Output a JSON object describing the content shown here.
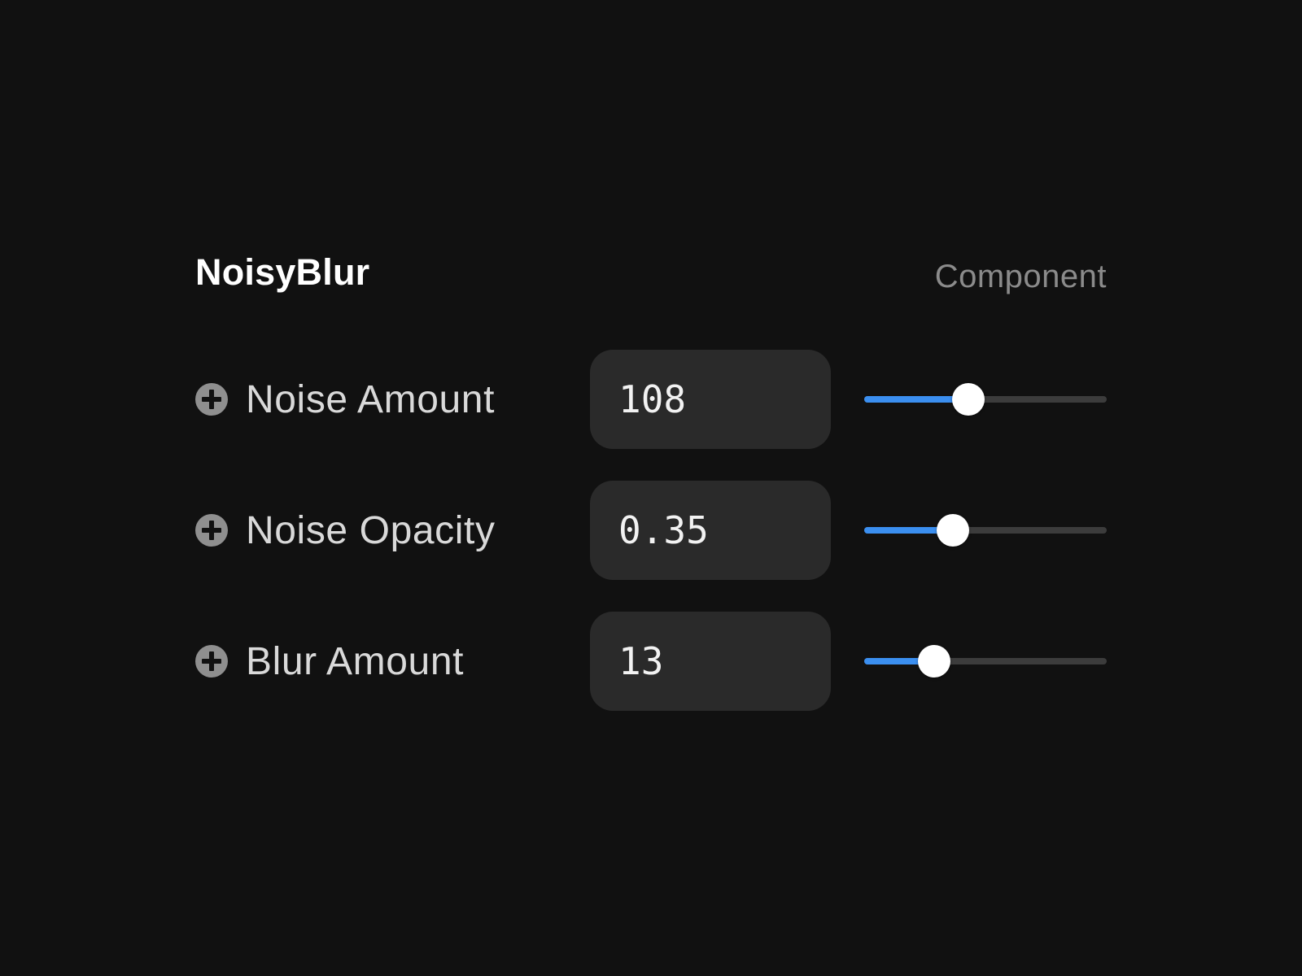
{
  "component": {
    "title": "NoisyBlur",
    "type_label": "Component"
  },
  "params": [
    {
      "label": "Noise Amount",
      "value": "108",
      "slider_fraction": 0.43,
      "add_icon": "plus-circle-icon"
    },
    {
      "label": "Noise Opacity",
      "value": "0.35",
      "slider_fraction": 0.365,
      "add_icon": "plus-circle-icon"
    },
    {
      "label": "Blur Amount",
      "value": "13",
      "slider_fraction": 0.29,
      "add_icon": "plus-circle-icon"
    }
  ],
  "colors": {
    "background": "#111111",
    "input_background": "#2a2a2a",
    "accent": "#3b8ff0",
    "track": "#3c3c3c",
    "thumb": "#ffffff",
    "icon": "#8f8f8f"
  }
}
